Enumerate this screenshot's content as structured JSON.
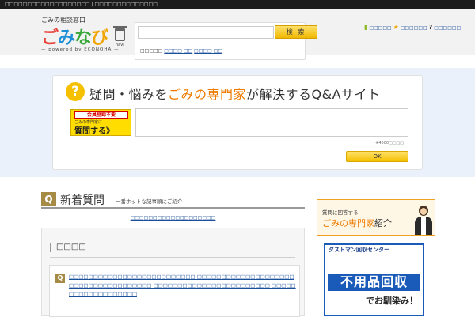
{
  "topbar": {
    "text": "□□□□□□□□□□□□□□□□□□□ | □□□□□□□□□□□□□□"
  },
  "header": {
    "logo_sub": "ごみの相談窓口",
    "logo_main_1": "ご",
    "logo_main_2": "み",
    "logo_main_3": "な",
    "logo_main_4": "び",
    "logo_navi": "navi",
    "logo_powered": "— powered by ECONOHA —",
    "search": {
      "value": "",
      "placeholder": "",
      "button_label": "検 索",
      "tags_prefix": "□□□□□",
      "tag1": "□□□□ □□",
      "tag2": "□□□□ □□"
    },
    "links": {
      "link1": "□□□□□",
      "star": "★",
      "link2": "□□□□□□",
      "q": "?",
      "link3": "□□□□□□"
    }
  },
  "qa": {
    "q_glyph": "?",
    "tagline_1": "疑問・悩みを",
    "tagline_hl": "ごみの専門家",
    "tagline_2": "が解決するQ&Aサイト",
    "badge_line1": "会員登録不要",
    "badge_line2": "ごみの専門家に",
    "badge_line3": "質問する》",
    "textarea_value": "",
    "char_note": "※4000□□□□",
    "ok_label": "OK"
  },
  "new_questions": {
    "q_glyph": "Q",
    "title": "新着質問",
    "subtitle": "一番ホットな記事順にご紹介",
    "notice_link": "□□□□□□□□□□□□□□□□□□□",
    "box_title": "□□□□",
    "item_q": "Q",
    "item_text": "□□□□□□□□□□□□□□□□□□□□□□□□□□ □□□□□□□□□□□□□□□□□□□□□□□□□□□□□□□□□□□□□ □□□□□□□□□□□□□□□□□□□□□□□□ □□□□□□□□□□□□□□□□□□□"
  },
  "sidebar": {
    "banner1_line1": "質問に回答する",
    "banner1_line2_hl": "ごみの専門家",
    "banner1_line2": "紹介",
    "banner2_top": "ダストマン回収センター",
    "banner2_big": "不用品回収",
    "banner2_small": "でお馴染み！"
  },
  "colors": {
    "accent_yellow": "#f5c000",
    "accent_orange": "#ee7b00",
    "link_blue": "#1a4f9a",
    "q_brown": "#a68b46",
    "band_blue": "#eaf1fb"
  }
}
